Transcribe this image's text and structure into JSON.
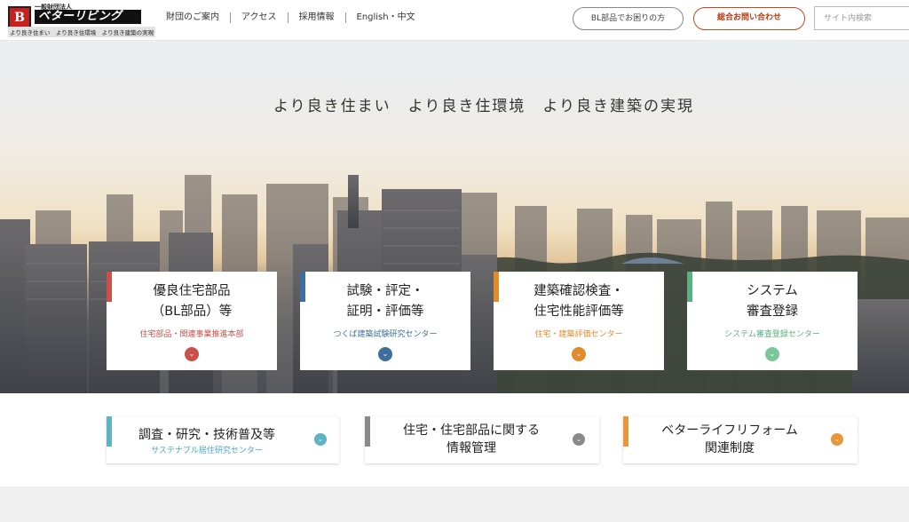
{
  "header": {
    "logo": {
      "small": "一般財団法人",
      "name": "ベターリビング",
      "tagline": "より良き住まい　より良き住環境　より良き建築の実現"
    },
    "nav": [
      "財団のご案内",
      "アクセス",
      "採用情報",
      "English・中文"
    ],
    "bl_button": "BL部品でお困りの方",
    "contact_button": "総合お問い合わせ",
    "search_placeholder": "サイト内検索"
  },
  "hero": {
    "tagline": "より良き住まい　より良き住環境　より良き建築の実現"
  },
  "cards": [
    {
      "title": "優良住宅部品\n（BL部品）等",
      "sub": "住宅部品・関連事業推進本部",
      "color": "#c9514a"
    },
    {
      "title": "試験・評定・\n証明・評価等",
      "sub": "つくば建築試験研究センター",
      "color": "#3e6e9e"
    },
    {
      "title": "建築確認検査・\n住宅性能評価等",
      "sub": "住宅・建築評価センター",
      "color": "#e38b2a"
    },
    {
      "title": "システム\n審査登録",
      "sub": "システム審査登録センター",
      "color": "#5ab07f"
    }
  ],
  "small_cards": [
    {
      "title": "調査・研究・技術普及等",
      "sub": "サステナブル居住研究センター",
      "color": "#5fb3c4"
    },
    {
      "title": "住宅・住宅部品に関する\n情報管理",
      "sub": "",
      "color": "#8a8a8a"
    },
    {
      "title": "ベターライフリフォーム\n関連制度",
      "sub": "",
      "color": "#e8963a"
    }
  ]
}
